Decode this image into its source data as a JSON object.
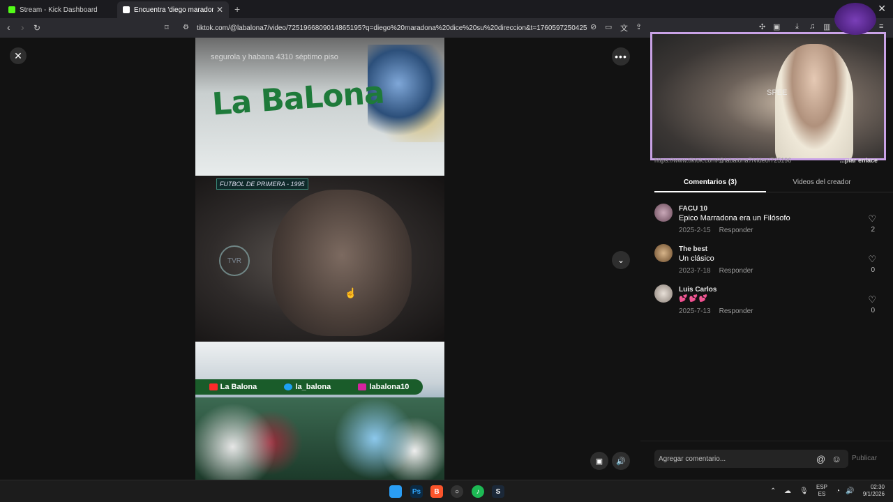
{
  "browser": {
    "tabs": [
      {
        "title": "Stream - Kick Dashboard",
        "favicon_color": "#53fc18"
      },
      {
        "title": "Encuentra 'diego maradona d",
        "favicon_color": "#ffffff"
      }
    ],
    "new_tab": "+",
    "window_close": "✕",
    "url": "tiktok.com/@labalona7/video/7251966809014865195?q=diego%20maradona%20dice%20su%20direccion&t=1760597250425"
  },
  "video": {
    "address_text": "segurola y habana 4310 séptimo piso",
    "logo_text": "La BaLona",
    "badge": "FUTBOL DE PRIMERA - 1995",
    "tvr_label": "TVR",
    "socials": [
      {
        "label": "La Balona",
        "color": "#ff2a2a"
      },
      {
        "label": "la_balona",
        "color": "#1da1f2"
      },
      {
        "label": "labalona10",
        "color": "#d6249f"
      }
    ]
  },
  "controls": {
    "close": "✕",
    "more": "•••",
    "down": "⌄",
    "mini_player": "▣",
    "volume": "🔊"
  },
  "webcam": {
    "overlay_text": "SPEE"
  },
  "panel": {
    "link_text": "https://www.tiktok.com/@labalona7/video/725196",
    "copy_link": "...piar enlace",
    "tabs": [
      {
        "label": "Comentarios (3)",
        "active": true
      },
      {
        "label": "Videos del creador",
        "active": false
      }
    ],
    "comments": [
      {
        "user": "FACU 10",
        "text": "Epico Marradona era un Filósofo",
        "date": "2025-2-15",
        "reply": "Responder",
        "likes": "2",
        "avatar_color": "#8a6a7a"
      },
      {
        "user": "The best",
        "text": "Un clásico",
        "date": "2023-7-18",
        "reply": "Responder",
        "likes": "0",
        "avatar_color": "#9a7a5a"
      },
      {
        "user": "Luis Carlos",
        "text": "💕💕💕",
        "date": "2025-7-13",
        "reply": "Responder",
        "likes": "0",
        "avatar_color": "#b8b0a8"
      }
    ],
    "composer": {
      "placeholder": "Agregar comentario...",
      "at": "@",
      "emoji": "☺",
      "publish": "Publicar"
    }
  },
  "taskbar": {
    "apps": [
      {
        "name": "windows-start",
        "label": "",
        "color": "#2a9df4"
      },
      {
        "name": "photoshop",
        "label": "Ps",
        "color": "#0b2a44"
      },
      {
        "name": "brave",
        "label": "B",
        "color": "#fb542b"
      },
      {
        "name": "obs",
        "label": "○",
        "color": "#333333"
      },
      {
        "name": "spotify",
        "label": "♪",
        "color": "#1db954"
      },
      {
        "name": "steam",
        "label": "S",
        "color": "#1b2838"
      }
    ],
    "lang_top": "ESP",
    "lang_bottom": "ES",
    "time": "02:30",
    "date": "9/1/2026"
  }
}
